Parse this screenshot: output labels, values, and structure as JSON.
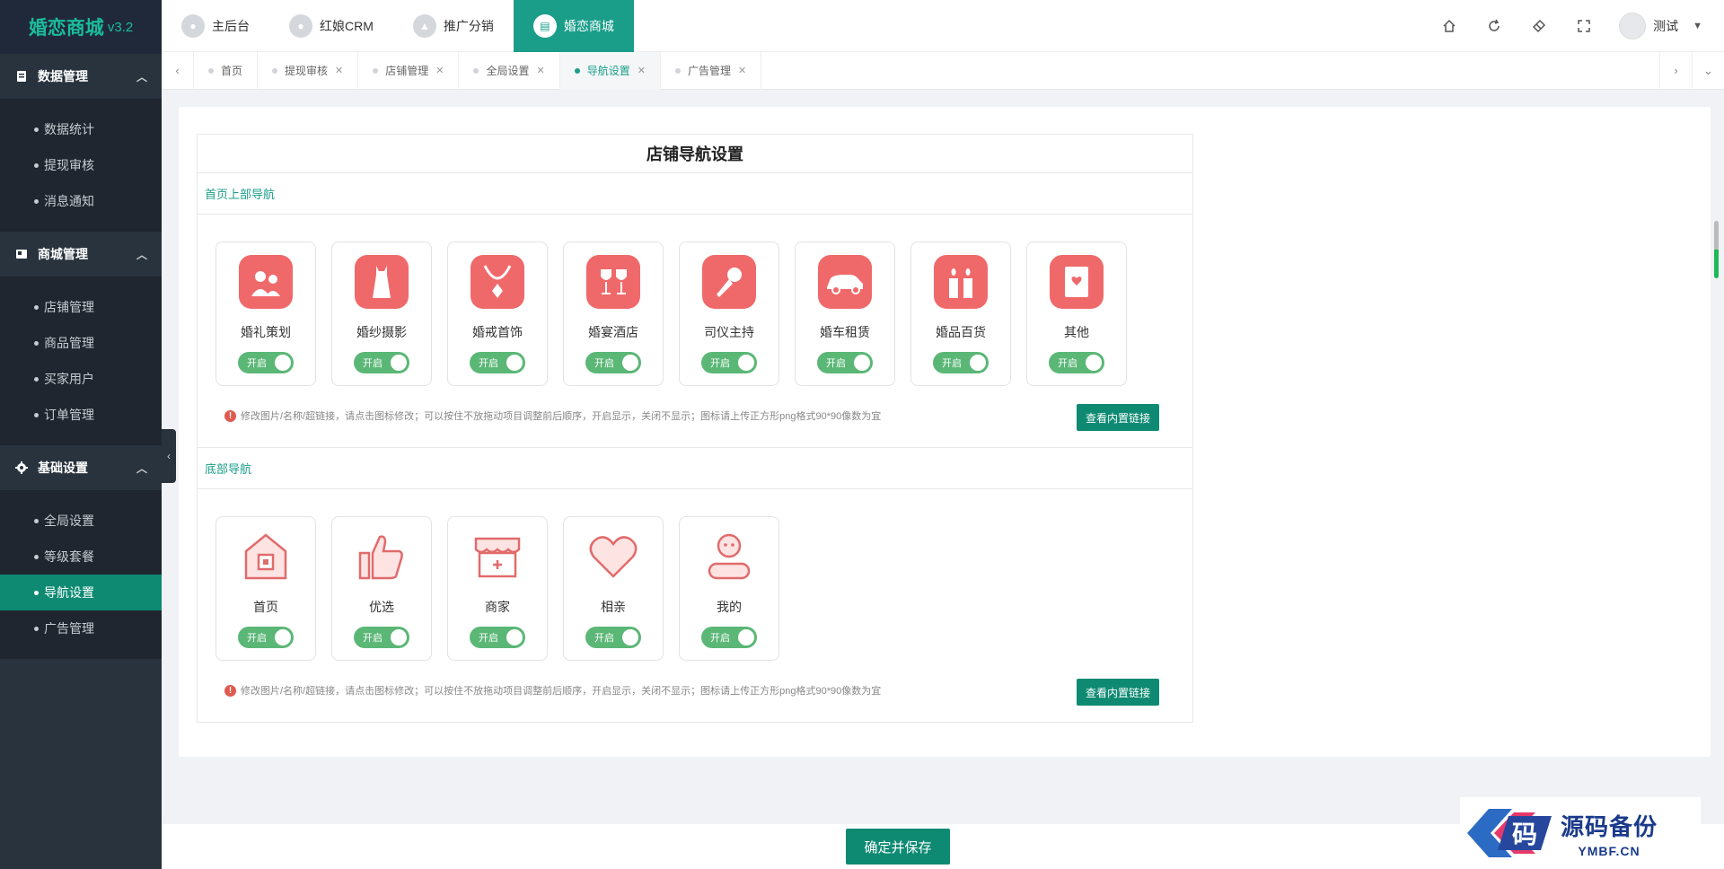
{
  "app": {
    "logo": "婚恋商城",
    "version": "v3.2"
  },
  "sidebar": {
    "groups": [
      {
        "label": "数据管理",
        "icon": "clipboard-icon",
        "items": [
          "数据统计",
          "提现审核",
          "消息通知"
        ]
      },
      {
        "label": "商城管理",
        "icon": "store-icon",
        "items": [
          "店铺管理",
          "商品管理",
          "买家用户",
          "订单管理"
        ]
      },
      {
        "label": "基础设置",
        "icon": "gear-icon",
        "items": [
          "全局设置",
          "等级套餐",
          "导航设置",
          "广告管理"
        ]
      }
    ],
    "active_item": "导航设置"
  },
  "topnav": [
    {
      "label": "主后台",
      "icon": "user-icon"
    },
    {
      "label": "红娘CRM",
      "icon": "matchmaker-icon"
    },
    {
      "label": "推广分销",
      "icon": "chart-icon"
    },
    {
      "label": "婚恋商城",
      "icon": "shop-icon",
      "active": true
    }
  ],
  "user": {
    "name": "测试"
  },
  "tabs": [
    {
      "label": "首页",
      "closable": false
    },
    {
      "label": "提现审核",
      "closable": true
    },
    {
      "label": "店铺管理",
      "closable": true
    },
    {
      "label": "全局设置",
      "closable": true
    },
    {
      "label": "导航设置",
      "closable": true,
      "active": true
    },
    {
      "label": "广告管理",
      "closable": true
    }
  ],
  "form": {
    "title": "店铺导航设置",
    "top_section": {
      "heading": "首页上部导航",
      "items": [
        {
          "label": "婚礼策划",
          "icon": "couple-icon",
          "toggle": "开启"
        },
        {
          "label": "婚纱摄影",
          "icon": "dress-icon",
          "toggle": "开启"
        },
        {
          "label": "婚戒首饰",
          "icon": "necklace-icon",
          "toggle": "开启"
        },
        {
          "label": "婚宴酒店",
          "icon": "wine-glass-icon",
          "toggle": "开启"
        },
        {
          "label": "司仪主持",
          "icon": "microphone-icon",
          "toggle": "开启"
        },
        {
          "label": "婚车租赁",
          "icon": "car-icon",
          "toggle": "开启"
        },
        {
          "label": "婚品百货",
          "icon": "candles-icon",
          "toggle": "开启"
        },
        {
          "label": "其他",
          "icon": "book-icon",
          "toggle": "开启"
        }
      ],
      "hint": "修改图片/名称/超链接，请点击图标修改；可以按住不放拖动项目调整前后顺序，开启显示，关闭不显示；图标请上传正方形png格式90*90像数为宜",
      "button": "查看内置链接"
    },
    "bottom_section": {
      "heading": "底部导航",
      "items": [
        {
          "label": "首页",
          "icon": "home-icon",
          "toggle": "开启"
        },
        {
          "label": "优选",
          "icon": "thumbs-up-icon",
          "toggle": "开启"
        },
        {
          "label": "商家",
          "icon": "storefront-icon",
          "toggle": "开启"
        },
        {
          "label": "相亲",
          "icon": "heart-icon",
          "toggle": "开启"
        },
        {
          "label": "我的",
          "icon": "profile-icon",
          "toggle": "开启"
        }
      ],
      "hint": "修改图片/名称/超链接，请点击图标修改；可以按住不放拖动项目调整前后顺序，开启显示，关闭不显示；图标请上传正方形png格式90*90像数为宜",
      "button": "查看内置链接"
    }
  },
  "footer": {
    "save_label": "确定并保存"
  },
  "watermark": {
    "cn": "源码备份",
    "en": "YMBF.CN",
    "badge": "码"
  },
  "colors": {
    "accent": "#1a9e8a",
    "accent_dark": "#0e8a73",
    "icon_red": "#f0696a",
    "toggle_green": "#5bb776",
    "sidebar_bg": "#28333e"
  }
}
